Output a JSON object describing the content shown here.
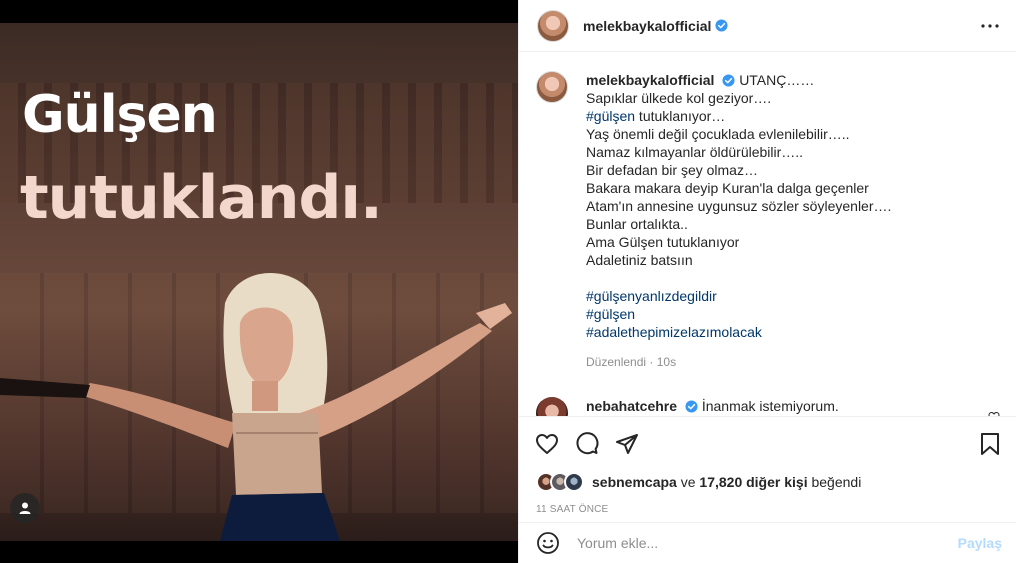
{
  "media": {
    "headline_line1": "Gülşen",
    "headline_line2": "tutuklandı."
  },
  "header": {
    "username": "melekbaykalofficial"
  },
  "caption": {
    "username": "melekbaykalofficial",
    "lines": [
      "UTANÇ……",
      "Sapıklar ülkede kol geziyor….",
      "#gülşen",
      " tutuklanıyor…",
      "Yaş önemli değil çocuklada evlenilebilir…..",
      "Namaz kılmayanlar öldürülebilir…..",
      "Bir defadan bir şey olmaz…",
      "Bakara makara deyip Kuran'la dalga geçenler",
      "Atam'ın annesine uygunsuz sözler söyleyenler….",
      "Bunlar ortalıkta..",
      "Ama Gülşen tutuklanıyor",
      "Adaletiniz batsıın"
    ],
    "hashtags": [
      "#gülşenyanlızdegildir",
      "#gülşen",
      "#adalethepimizelazımolacak"
    ],
    "edited": "Düzenlendi",
    "age": "10s"
  },
  "comment": {
    "username": "nebahatcehre",
    "text": "İnanmak istemiyorum."
  },
  "likes": {
    "first_user": "sebnemcapa",
    "and": "ve",
    "count_text": "17,820 diğer kişi",
    "suffix": "beğendi"
  },
  "timestamp": "11 SAAT ÖNCE",
  "add_comment": {
    "placeholder": "Yorum ekle...",
    "post_label": "Paylaş"
  },
  "colors": {
    "verified": "#3897f0",
    "hashtag": "#00376b",
    "post_disabled": "#b3dbff"
  }
}
